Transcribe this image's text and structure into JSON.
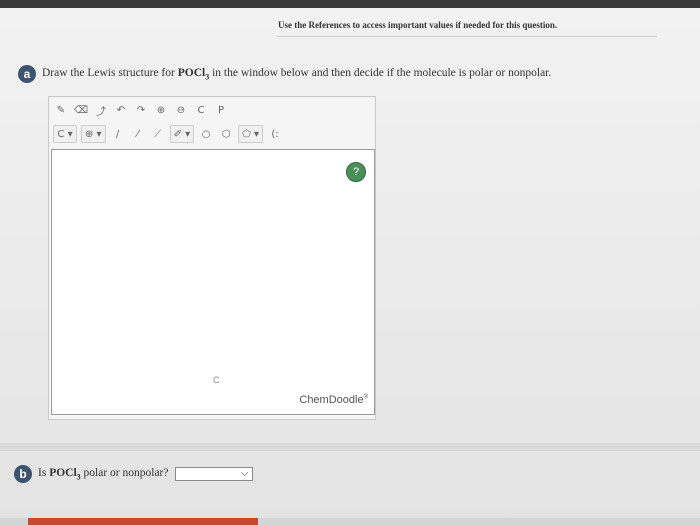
{
  "header": {
    "references_text": "Use the References to access important values if needed for this question."
  },
  "question_a": {
    "badge": "a",
    "text_before": "Draw the Lewis structure for ",
    "formula_main": "POCl",
    "formula_sub": "3",
    "text_after": " in the window below and then decide if the molecule is polar or nonpolar."
  },
  "editor": {
    "toolbar_row1": [
      {
        "name": "clear-icon",
        "glyph": "✎"
      },
      {
        "name": "eraser-icon",
        "glyph": "⌫"
      },
      {
        "name": "lasso-icon",
        "glyph": "⤴"
      },
      {
        "name": "undo-icon",
        "glyph": "↶"
      },
      {
        "name": "redo-icon",
        "glyph": "↷"
      },
      {
        "name": "zoom-in-icon",
        "glyph": "⊕"
      },
      {
        "name": "zoom-out-icon",
        "glyph": "⊖"
      },
      {
        "name": "copy-icon",
        "glyph": "C"
      },
      {
        "name": "paste-icon",
        "glyph": "P"
      }
    ],
    "toolbar_row2": [
      {
        "name": "atom-carbon-dropdown",
        "glyph": "C ▾"
      },
      {
        "name": "charge-plus-dropdown",
        "glyph": "⊕ ▾"
      },
      {
        "name": "single-bond-icon",
        "glyph": "/"
      },
      {
        "name": "double-bond-icon",
        "glyph": "⁄"
      },
      {
        "name": "wedge-bond-icon",
        "glyph": "⟋"
      },
      {
        "name": "bond-dropdown",
        "glyph": "✐ ▾"
      },
      {
        "name": "ring-cyclopropane-icon",
        "glyph": "○"
      },
      {
        "name": "ring-cyclohexane-icon",
        "glyph": "⬡"
      },
      {
        "name": "ring-dropdown",
        "glyph": "⬠ ▾"
      },
      {
        "name": "lone-pair-icon",
        "glyph": "(:"
      }
    ],
    "help_glyph": "?",
    "canvas_atom": "C",
    "brand": "ChemDoodle",
    "brand_mark": "®"
  },
  "question_b": {
    "badge": "b",
    "text_before": "Is ",
    "formula_main": "POCl",
    "formula_sub": "3",
    "text_after": " polar or nonpolar?",
    "select_value": ""
  },
  "colors": {
    "badge": "#3d5470",
    "help": "#4a8f5a",
    "button": "#c24a33"
  }
}
